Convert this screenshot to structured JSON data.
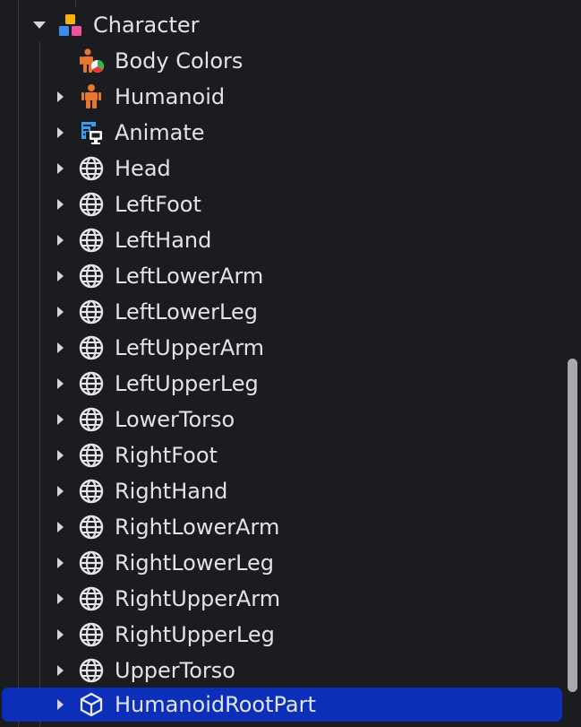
{
  "tree": {
    "root": {
      "label": "Character",
      "icon": "model-icon",
      "expanded": true
    },
    "children": [
      {
        "label": "Body Colors",
        "icon": "body-colors-icon",
        "expandable": false
      },
      {
        "label": "Humanoid",
        "icon": "humanoid-icon",
        "expandable": true
      },
      {
        "label": "Animate",
        "icon": "local-script-icon",
        "expandable": true
      },
      {
        "label": "Head",
        "icon": "mesh-part-icon",
        "expandable": true
      },
      {
        "label": "LeftFoot",
        "icon": "mesh-part-icon",
        "expandable": true
      },
      {
        "label": "LeftHand",
        "icon": "mesh-part-icon",
        "expandable": true
      },
      {
        "label": "LeftLowerArm",
        "icon": "mesh-part-icon",
        "expandable": true
      },
      {
        "label": "LeftLowerLeg",
        "icon": "mesh-part-icon",
        "expandable": true
      },
      {
        "label": "LeftUpperArm",
        "icon": "mesh-part-icon",
        "expandable": true
      },
      {
        "label": "LeftUpperLeg",
        "icon": "mesh-part-icon",
        "expandable": true
      },
      {
        "label": "LowerTorso",
        "icon": "mesh-part-icon",
        "expandable": true
      },
      {
        "label": "RightFoot",
        "icon": "mesh-part-icon",
        "expandable": true
      },
      {
        "label": "RightHand",
        "icon": "mesh-part-icon",
        "expandable": true
      },
      {
        "label": "RightLowerArm",
        "icon": "mesh-part-icon",
        "expandable": true
      },
      {
        "label": "RightLowerLeg",
        "icon": "mesh-part-icon",
        "expandable": true
      },
      {
        "label": "RightUpperArm",
        "icon": "mesh-part-icon",
        "expandable": true
      },
      {
        "label": "RightUpperLeg",
        "icon": "mesh-part-icon",
        "expandable": true
      },
      {
        "label": "UpperTorso",
        "icon": "mesh-part-icon",
        "expandable": true
      },
      {
        "label": "HumanoidRootPart",
        "icon": "part-cube-icon",
        "expandable": true,
        "selected": true
      }
    ]
  },
  "colors": {
    "background": "#1b1c20",
    "selection": "#0b2fb8",
    "text": "#e2e3e6",
    "humanoid_orange": "#e8762c",
    "script_blue": "#3c9cf0",
    "model_yellow": "#f7b500",
    "model_blue": "#3c8cf0",
    "model_pink": "#f052a0"
  }
}
